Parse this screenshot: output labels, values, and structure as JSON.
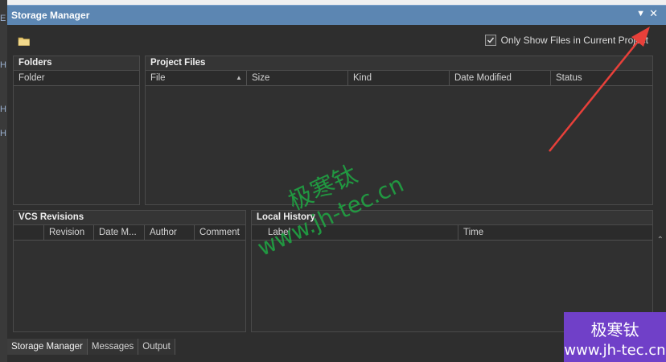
{
  "window": {
    "title": "Storage Manager",
    "menu_icon": "dropdown-arrow-icon",
    "close_icon": "close-icon"
  },
  "left_strip": {
    "letters": [
      "E",
      "H",
      "H",
      "H"
    ]
  },
  "toolbar": {
    "folder_icon": "folder-icon",
    "checkbox": {
      "label": "Only Show Files in Current Project",
      "checked": true
    }
  },
  "folders_panel": {
    "title": "Folders",
    "columns": [
      "Folder"
    ]
  },
  "project_files_panel": {
    "title": "Project Files",
    "columns": [
      "File",
      "Size",
      "Kind",
      "Date Modified",
      "Status"
    ],
    "sorted_column": "File"
  },
  "vcs_panel": {
    "title": "VCS Revisions",
    "columns": [
      "",
      "Revision",
      "Date M...",
      "Author",
      "Comment"
    ]
  },
  "local_history_panel": {
    "title": "Local History",
    "columns": [
      "Label",
      "Time"
    ]
  },
  "bottom_tabs": [
    {
      "label": "Storage Manager",
      "active": true
    },
    {
      "label": "Messages",
      "active": false
    },
    {
      "label": "Output",
      "active": false
    }
  ],
  "watermark": {
    "cn": "极寒钛",
    "url": "www.jh-tec.cn"
  },
  "badge": {
    "cn": "极寒钛",
    "url": "www.jh-tec.cn"
  },
  "colors": {
    "titlebar": "#5c86b2",
    "annotation_arrow": "#e8403a",
    "badge": "#7040c8",
    "watermark": "#1faa44"
  }
}
